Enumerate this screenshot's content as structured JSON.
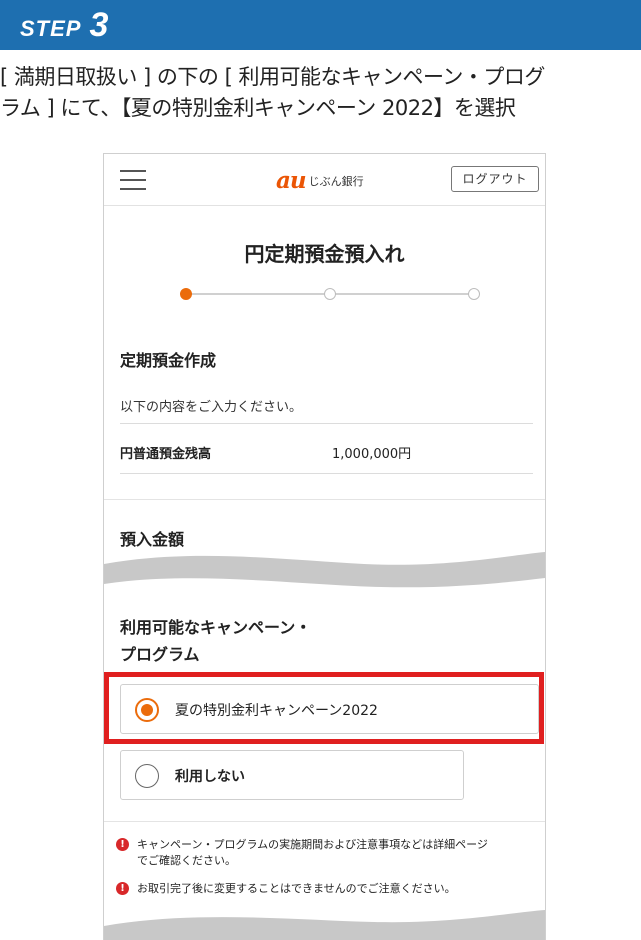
{
  "step": {
    "word": "STEP",
    "number": "3"
  },
  "instruction": {
    "line1": "[ 満期日取扱い ] の下の [ 利用可能なキャンペーン・プログ",
    "line2": "ラム ] にて、【夏の特別金利キャンペーン 2022】を選択"
  },
  "header": {
    "logo_mark": "au",
    "logo_text": "じぶん銀行",
    "logout_label": "ログアウト"
  },
  "page": {
    "title": "円定期預金預入れ",
    "progress": {
      "current_step": 1,
      "total_steps": 3
    }
  },
  "section": {
    "title": "定期預金作成",
    "instruction": "以下の内容をご入力ください。",
    "balance_label": "円普通預金残高",
    "balance_value": "1,000,000円"
  },
  "deposit": {
    "title": "預入金額"
  },
  "campaign": {
    "title_line1": "利用可能なキャンペーン・",
    "title_line2": "プログラム",
    "options": [
      {
        "label": "夏の特別金利キャンペーン2022",
        "selected": true
      },
      {
        "label": "利用しない",
        "selected": false
      }
    ]
  },
  "notes": [
    {
      "line1": "キャンペーン・プログラムの実施期間および注意事項などは詳細ページ",
      "line2": "でご確認ください。"
    },
    {
      "line1": "お取引完了後に変更することはできませんのでご注意ください。",
      "line2": ""
    }
  ],
  "colors": {
    "banner": "#1e6fb0",
    "accent": "#eb6c0c",
    "highlight": "#e01f1f",
    "warning": "#d8282a"
  }
}
